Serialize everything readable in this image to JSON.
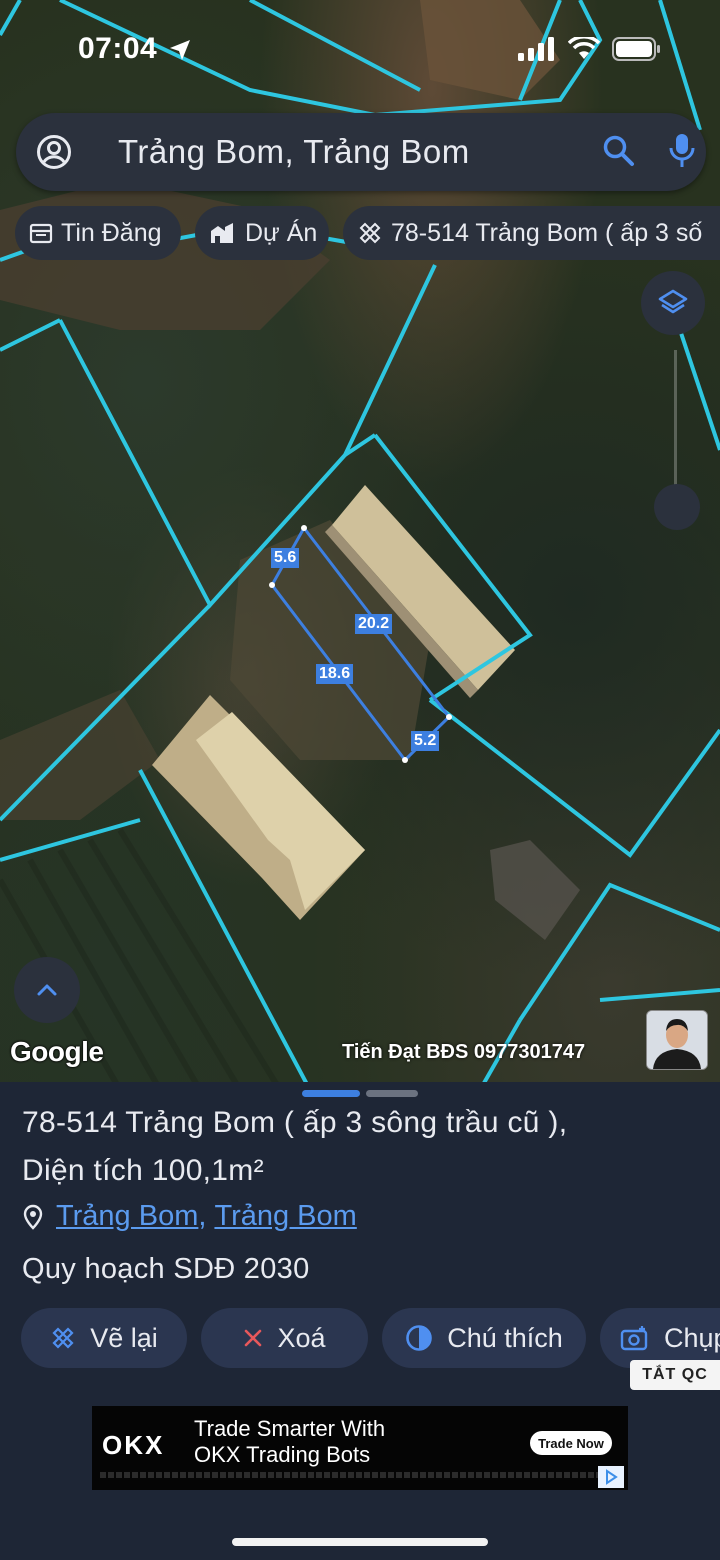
{
  "status": {
    "time": "07:04"
  },
  "search": {
    "query": "Trảng Bom, Trảng Bom"
  },
  "chips": [
    {
      "label": "Tin Đăng",
      "icon": "calendar-icon"
    },
    {
      "label": "Dự Án",
      "icon": "building-icon"
    },
    {
      "label": "78-514 Trảng Bom ( ấp 3 số",
      "icon": "measure-icon"
    }
  ],
  "measurements": {
    "top": "5.6",
    "right": "20.2",
    "left": "18.6",
    "bottom": "5.2"
  },
  "map": {
    "google": "Google",
    "watermark": "Tiến Đạt BĐS 0977301747"
  },
  "sheet": {
    "title_line1": "78-514 Trảng Bom ( ấp 3 sông trầu cũ ),",
    "title_line2": "Diện tích 100,1m²",
    "location_a": "Trảng Bom",
    "location_sep": ",",
    "location_b": "Trảng Bom",
    "plan": "Quy hoạch SDĐ 2030"
  },
  "actions": {
    "redraw": "Vẽ lại",
    "delete": "Xoá",
    "legend": "Chú thích",
    "capture": "Chụp"
  },
  "ads": {
    "off_label": "TẮT QC",
    "brand": "OKX",
    "line1": "Trade Smarter With",
    "line2": "OKX Trading Bots",
    "cta": "Trade Now"
  },
  "colors": {
    "accent": "#3d7fe0",
    "parcel_line": "#2ec6e0",
    "surface": "#2b313d",
    "sheet_bg": "#1e2636"
  }
}
